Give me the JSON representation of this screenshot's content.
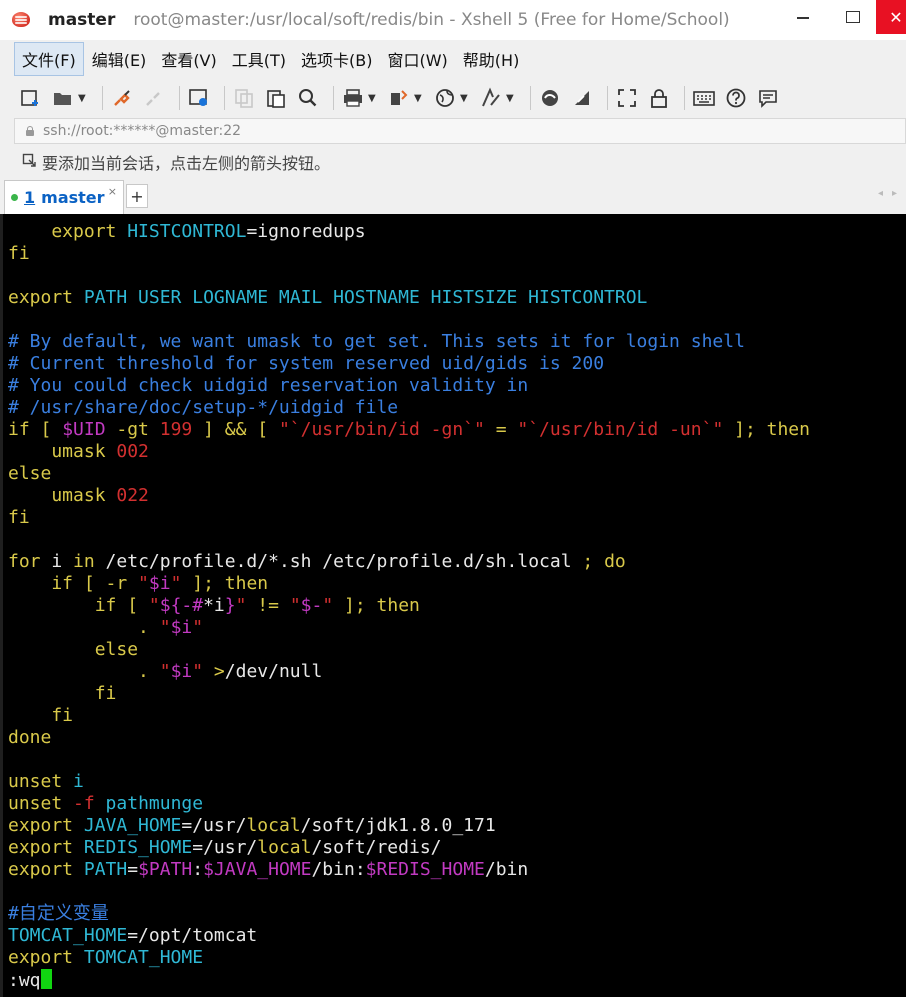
{
  "window": {
    "app_name": "master",
    "title": "root@master:/usr/local/soft/redis/bin - Xshell 5 (Free for Home/School)",
    "close_glyph": "✕"
  },
  "menu": [
    {
      "label": "文件(F)"
    },
    {
      "label": "编辑(E)"
    },
    {
      "label": "查看(V)"
    },
    {
      "label": "工具(T)"
    },
    {
      "label": "选项卡(B)"
    },
    {
      "label": "窗口(W)"
    },
    {
      "label": "帮助(H)"
    }
  ],
  "address": {
    "text": "ssh://root:******@master:22"
  },
  "hint": {
    "text": "要添加当前会话，点击左侧的箭头按钮。"
  },
  "tab": {
    "number": "1",
    "label": "master",
    "close_glyph": "×",
    "add_glyph": "+",
    "nav_left": "◂",
    "nav_right": "▸"
  },
  "terminal": {
    "lines": [
      [
        [
          "    export ",
          "y"
        ],
        [
          "HISTCONTROL",
          "c"
        ],
        [
          "=ignoredups",
          "w"
        ]
      ],
      [
        [
          "fi",
          "y"
        ]
      ],
      [],
      [
        [
          "export ",
          "y"
        ],
        [
          "PATH USER LOGNAME MAIL HOSTNAME HISTSIZE HISTCONTROL",
          "c"
        ]
      ],
      [],
      [
        [
          "# By default, we want umask to get set. This sets it for login shell",
          "b"
        ]
      ],
      [
        [
          "# Current threshold for system reserved uid/gids is 200",
          "b"
        ]
      ],
      [
        [
          "# You could check uidgid reservation validity in",
          "b"
        ]
      ],
      [
        [
          "# /usr/share/doc/setup-*/uidgid file",
          "b"
        ]
      ],
      [
        [
          "if [ ",
          "y"
        ],
        [
          "$UID",
          "m"
        ],
        [
          " -gt ",
          "y"
        ],
        [
          "199",
          "r"
        ],
        [
          " ] && [ ",
          "y"
        ],
        [
          "\"`/usr/bin/id -gn`\"",
          "r"
        ],
        [
          " = ",
          "y"
        ],
        [
          "\"`/usr/bin/id -un`\"",
          "r"
        ],
        [
          " ]; then",
          "y"
        ]
      ],
      [
        [
          "    umask ",
          "y"
        ],
        [
          "002",
          "r"
        ]
      ],
      [
        [
          "else",
          "y"
        ]
      ],
      [
        [
          "    umask ",
          "y"
        ],
        [
          "022",
          "r"
        ]
      ],
      [
        [
          "fi",
          "y"
        ]
      ],
      [],
      [
        [
          "for",
          "y"
        ],
        [
          " i ",
          "w"
        ],
        [
          "in",
          "y"
        ],
        [
          " /etc/profile.d/*.sh /etc/profile.d/sh.local ",
          "w"
        ],
        [
          "; do",
          "y"
        ]
      ],
      [
        [
          "    if [ -r ",
          "y"
        ],
        [
          "\"",
          "r"
        ],
        [
          "$i",
          "m"
        ],
        [
          "\"",
          "r"
        ],
        [
          " ]; then",
          "y"
        ]
      ],
      [
        [
          "        if [ ",
          "y"
        ],
        [
          "\"",
          "r"
        ],
        [
          "${-#",
          "m"
        ],
        [
          "*i",
          "w"
        ],
        [
          "}",
          "m"
        ],
        [
          "\"",
          "r"
        ],
        [
          " != ",
          "y"
        ],
        [
          "\"",
          "r"
        ],
        [
          "$-",
          "m"
        ],
        [
          "\"",
          "r"
        ],
        [
          " ]; then",
          "y"
        ]
      ],
      [
        [
          "            . ",
          "y"
        ],
        [
          "\"",
          "r"
        ],
        [
          "$i",
          "m"
        ],
        [
          "\"",
          "r"
        ]
      ],
      [
        [
          "        else",
          "y"
        ]
      ],
      [
        [
          "            . ",
          "y"
        ],
        [
          "\"",
          "r"
        ],
        [
          "$i",
          "m"
        ],
        [
          "\"",
          "r"
        ],
        [
          " >",
          "y"
        ],
        [
          "/dev/null",
          "w"
        ]
      ],
      [
        [
          "        fi",
          "y"
        ]
      ],
      [
        [
          "    fi",
          "y"
        ]
      ],
      [
        [
          "done",
          "y"
        ]
      ],
      [],
      [
        [
          "unset ",
          "y"
        ],
        [
          "i",
          "c"
        ]
      ],
      [
        [
          "unset ",
          "y"
        ],
        [
          "-f",
          "r"
        ],
        [
          " pathmunge",
          "c"
        ]
      ],
      [
        [
          "export ",
          "y"
        ],
        [
          "JAVA_HOME",
          "c"
        ],
        [
          "=/usr/",
          "w"
        ],
        [
          "local",
          "y"
        ],
        [
          "/soft/jdk1.8.0_171",
          "w"
        ]
      ],
      [
        [
          "export ",
          "y"
        ],
        [
          "REDIS_HOME",
          "c"
        ],
        [
          "=/usr/",
          "w"
        ],
        [
          "local",
          "y"
        ],
        [
          "/soft/redis/",
          "w"
        ]
      ],
      [
        [
          "export ",
          "y"
        ],
        [
          "PATH",
          "c"
        ],
        [
          "=",
          "w"
        ],
        [
          "$PATH",
          "m"
        ],
        [
          ":",
          "w"
        ],
        [
          "$JAVA_HOME",
          "m"
        ],
        [
          "/bin:",
          "w"
        ],
        [
          "$REDIS_HOME",
          "m"
        ],
        [
          "/bin",
          "w"
        ]
      ],
      [],
      [
        [
          "#自定义变量",
          "b"
        ]
      ],
      [
        [
          "TOMCAT_HOME",
          "c"
        ],
        [
          "=/opt/tomcat",
          "w"
        ]
      ],
      [
        [
          "export ",
          "y"
        ],
        [
          "TOMCAT_HOME",
          "c"
        ]
      ],
      [
        [
          ":wq",
          "w"
        ],
        [
          "__CURSOR__",
          "cursor"
        ]
      ]
    ]
  }
}
